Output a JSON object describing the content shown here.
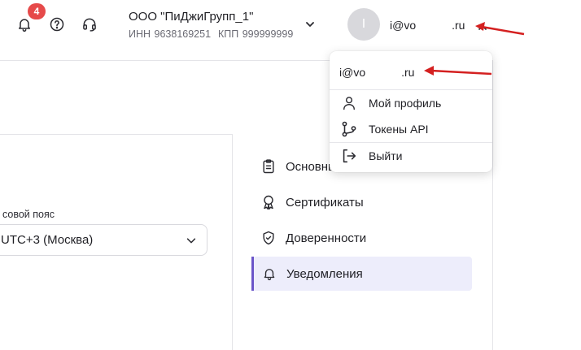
{
  "header": {
    "notification_count": "4",
    "org_name": "ООО \"ПиДжиГрупп_1\"",
    "org_inn": "ИНН 9638169251",
    "org_kpp": "КПП 999999999",
    "avatar_initial": "I",
    "user_email_start": "i@vo",
    "user_email_end": ".ru"
  },
  "settings": {
    "timezone_label": "совой пояс",
    "timezone_value": "UTC+3 (Москва)"
  },
  "side_nav": {
    "items": [
      {
        "label": "Основные",
        "icon": "clipboard-icon"
      },
      {
        "label": "Сертификаты",
        "icon": "certificate-icon"
      },
      {
        "label": "Доверенности",
        "icon": "shield-check-icon"
      },
      {
        "label": "Уведомления",
        "icon": "bell-icon",
        "active": true
      }
    ]
  },
  "user_menu": {
    "email_start": "i@vo",
    "email_end": ".ru",
    "items": [
      {
        "label": "Мой профиль",
        "icon": "user-icon"
      },
      {
        "label": "Токены API",
        "icon": "git-branch-icon"
      },
      {
        "label": "Выйти",
        "icon": "logout-icon"
      }
    ]
  },
  "colors": {
    "badge": "#e64a4a",
    "accent": "#6a55c9",
    "active_bg": "#ededfb",
    "annotation_arrow": "#d42020"
  }
}
